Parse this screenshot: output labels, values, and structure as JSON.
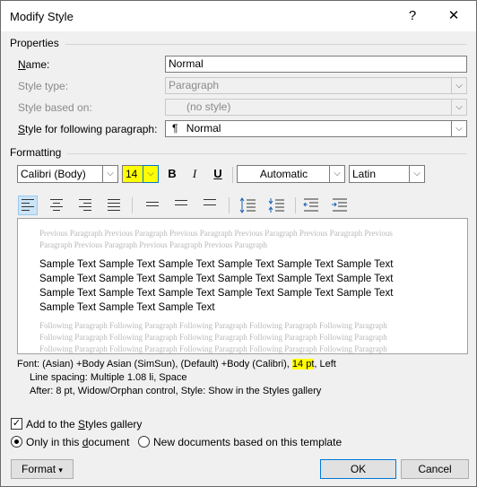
{
  "window": {
    "title": "Modify Style",
    "help": "?",
    "close": "✕"
  },
  "properties": {
    "heading": "Properties",
    "name_label": "Name:",
    "name_value": "Normal",
    "style_type_label": "Style type:",
    "style_type_value": "Paragraph",
    "based_on_label": "Style based on:",
    "based_on_value": "(no style)",
    "following_label": "Style for following paragraph:",
    "following_value": "Normal",
    "following_icon": "¶"
  },
  "formatting": {
    "heading": "Formatting",
    "font_name": "Calibri (Body)",
    "font_size": "14",
    "bold": "B",
    "italic": "I",
    "underline": "U",
    "color": "Automatic",
    "script": "Latin"
  },
  "preview": {
    "previous": "Previous Paragraph Previous Paragraph Previous Paragraph Previous Paragraph Previous Paragraph Previous Paragraph Previous Paragraph Previous Paragraph Previous Paragraph",
    "sample": "Sample Text Sample Text Sample Text Sample Text Sample Text Sample Text Sample Text Sample Text Sample Text Sample Text Sample Text Sample Text Sample Text Sample Text Sample Text Sample Text Sample Text Sample Text Sample Text Sample Text Sample Text",
    "following": "Following Paragraph Following Paragraph Following Paragraph Following Paragraph Following Paragraph Following Paragraph Following Paragraph Following Paragraph Following Paragraph Following Paragraph Following Paragraph Following Paragraph Following Paragraph Following Paragraph Following Paragraph"
  },
  "description": {
    "line1_pre": "Font: (Asian) +Body Asian (SimSun), (Default) +Body (Calibri), ",
    "line1_hl": "14 pt",
    "line1_post": ", Left",
    "line2": "Line spacing:  Multiple 1.08 li, Space",
    "line3": "After:  8 pt, Widow/Orphan control, Style: Show in the Styles gallery"
  },
  "options": {
    "add_gallery_pre": "Add to the ",
    "add_gallery_u": "S",
    "add_gallery_post": "tyles gallery",
    "add_gallery_checked": true,
    "only_doc_pre": "Only in this ",
    "only_doc_u": "d",
    "only_doc_post": "ocument",
    "new_docs": "New documents based on this template"
  },
  "buttons": {
    "format": "Format",
    "format_arrow": "▾",
    "ok": "OK",
    "cancel": "Cancel"
  },
  "colors": {
    "highlight": "#ffff00",
    "selected": "#cce4f7",
    "accent": "#0078d7"
  }
}
